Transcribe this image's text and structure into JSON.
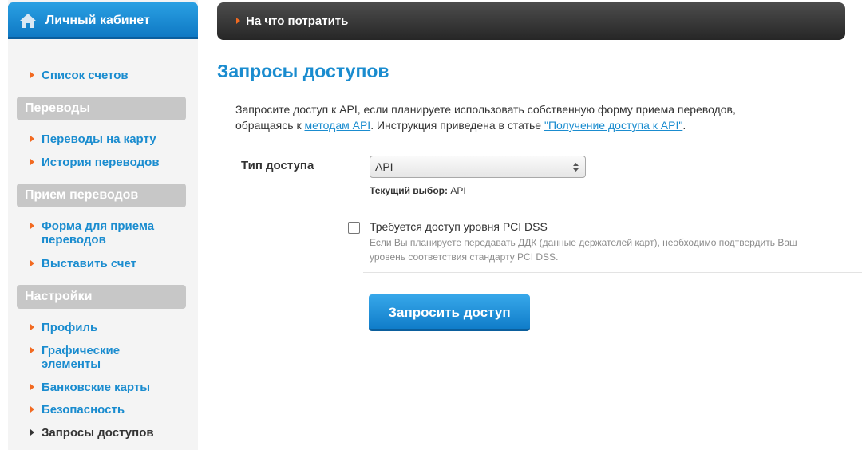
{
  "sidebar": {
    "title": "Личный кабинет",
    "top_items": [
      {
        "label": "Список счетов"
      }
    ],
    "sections": [
      {
        "title": "Переводы",
        "items": [
          {
            "label": "Переводы на карту"
          },
          {
            "label": "История переводов"
          }
        ]
      },
      {
        "title": "Прием переводов",
        "items": [
          {
            "label": "Форма для приема\nпереводов"
          },
          {
            "label": "Выставить счет"
          }
        ]
      },
      {
        "title": "Настройки",
        "items": [
          {
            "label": "Профиль"
          },
          {
            "label": "Графические\nэлементы"
          },
          {
            "label": "Банковские карты"
          },
          {
            "label": "Безопасность"
          },
          {
            "label": "Запросы доступов",
            "active": true
          }
        ]
      }
    ]
  },
  "topbar": {
    "title": "На что потратить"
  },
  "page": {
    "title": "Запросы доступов",
    "intro_1": "Запросите доступ к API, если планируете использовать собственную форму приема переводов,",
    "intro_2_prefix": "обращаясь к ",
    "intro_link_1": "методам API",
    "intro_2_mid": ". Инструкция приведена в статье ",
    "intro_link_2": "\"Получение доступа к API\"",
    "intro_2_suffix": "."
  },
  "form": {
    "access_type_label": "Тип доступа",
    "access_type_value": "API",
    "current_choice_label": "Текущий выбор:",
    "current_choice_value": "API",
    "pci_label": "Требуется доступ уровня PCI DSS",
    "pci_hint_1": "Если Вы планируете передавать ДДК (данные держателей карт), необходимо подтвердить Ваш",
    "pci_hint_2": "уровень соответствия стандарту PCI DSS.",
    "pci_checked": false,
    "submit_label": "Запросить доступ"
  },
  "colors": {
    "accent": "#1a8ccf",
    "bullet": "#f26a21",
    "section_bg": "#c7c7c7",
    "topbar_bg": "#333333"
  }
}
